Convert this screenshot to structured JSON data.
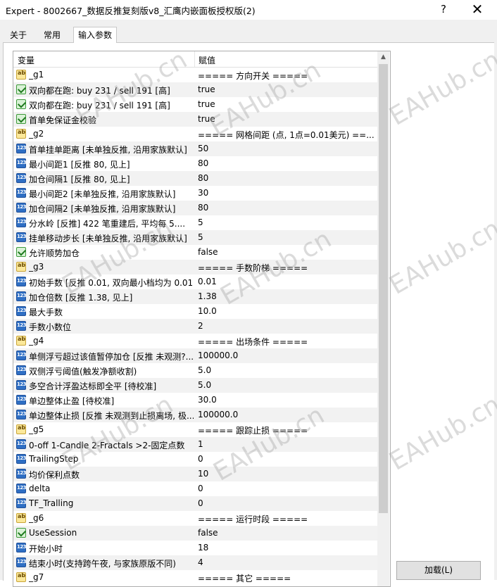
{
  "window": {
    "title": "Expert - 8002667_数据反推复刻版v8_汇鹰内嵌面板授权版(2)",
    "help_label": "?",
    "close_label": "✕"
  },
  "tabs": [
    {
      "label": "关于"
    },
    {
      "label": "常用"
    },
    {
      "label": "输入参数"
    }
  ],
  "table": {
    "col_variable": "变量",
    "col_value": "赋值",
    "rows": [
      {
        "icon": "ab",
        "var": "_g1",
        "val": "===== 方向开关 ====="
      },
      {
        "icon": "bool",
        "var": "双向都在跑: buy 231 / sell 191 [高]",
        "val": "true"
      },
      {
        "icon": "bool",
        "var": "双向都在跑: buy 231 / sell 191 [高]",
        "val": "true"
      },
      {
        "icon": "bool",
        "var": "首单免保证金校验",
        "val": "true"
      },
      {
        "icon": "ab",
        "var": "_g2",
        "val": "===== 网格间距 (点, 1点=0.01美元) ==..."
      },
      {
        "icon": "num",
        "var": "首单挂单距离 [未单独反推, 沿用家族默认]",
        "val": "50"
      },
      {
        "icon": "num",
        "var": "最小间距1    [反推 80, 见上]",
        "val": "80"
      },
      {
        "icon": "num",
        "var": "加仓间隔1    [反推 80, 见上]",
        "val": "80"
      },
      {
        "icon": "num",
        "var": "最小间距2    [未单独反推, 沿用家族默认]",
        "val": "30"
      },
      {
        "icon": "num",
        "var": "加仓间隔2    [未单独反推, 沿用家族默认]",
        "val": "80"
      },
      {
        "icon": "num",
        "var": "分水岭    [反推] 422 笔重建后, 平均每 5....",
        "val": "5"
      },
      {
        "icon": "num",
        "var": "挂单移动步长 [未单独反推, 沿用家族默认]",
        "val": "5"
      },
      {
        "icon": "bool",
        "var": "允许顺势加仓",
        "val": "false"
      },
      {
        "icon": "ab",
        "var": "_g3",
        "val": "===== 手数阶梯 ====="
      },
      {
        "icon": "num",
        "var": "初始手数 [反推 0.01, 双向最小档均为 0.01]",
        "val": "0.01"
      },
      {
        "icon": "num",
        "var": "加仓倍数 [反推 1.38, 见上]",
        "val": "1.38"
      },
      {
        "icon": "num",
        "var": "最大手数",
        "val": "10.0"
      },
      {
        "icon": "num",
        "var": "手数小数位",
        "val": "2"
      },
      {
        "icon": "ab",
        "var": "_g4",
        "val": "===== 出场条件 ====="
      },
      {
        "icon": "num",
        "var": "单侧浮亏超过该值暂停加仓 [反推 未观测?...",
        "val": "100000.0"
      },
      {
        "icon": "num",
        "var": "双侧浮亏阈值(触发净额收割)",
        "val": "5.0"
      },
      {
        "icon": "num",
        "var": "多空合计浮盈达标即全平 [待校准]",
        "val": "5.0"
      },
      {
        "icon": "num",
        "var": "单边整体止盈 [待校准]",
        "val": "30.0"
      },
      {
        "icon": "num",
        "var": "单边整体止损 [反推 未观测到止损离场, 极...",
        "val": "100000.0"
      },
      {
        "icon": "ab",
        "var": "_g5",
        "val": "===== 跟踪止损 ====="
      },
      {
        "icon": "num",
        "var": "0-off 1-Candle 2-Fractals >2-固定点数",
        "val": "1"
      },
      {
        "icon": "num",
        "var": "TrailingStep",
        "val": "0"
      },
      {
        "icon": "num",
        "var": "均价保利点数",
        "val": "10"
      },
      {
        "icon": "num",
        "var": "delta",
        "val": "0"
      },
      {
        "icon": "num",
        "var": "TF_Tralling",
        "val": "0"
      },
      {
        "icon": "ab",
        "var": "_g6",
        "val": "===== 运行时段 ====="
      },
      {
        "icon": "bool",
        "var": "UseSession",
        "val": "false"
      },
      {
        "icon": "num",
        "var": "开始小时",
        "val": "18"
      },
      {
        "icon": "num",
        "var": "结束小时(支持跨午夜, 与家族原版不同)",
        "val": "4"
      },
      {
        "icon": "ab",
        "var": "_g7",
        "val": "===== 其它 ====="
      }
    ]
  },
  "buttons": {
    "load": "加载(L)"
  },
  "watermark": "EAHub.cn"
}
